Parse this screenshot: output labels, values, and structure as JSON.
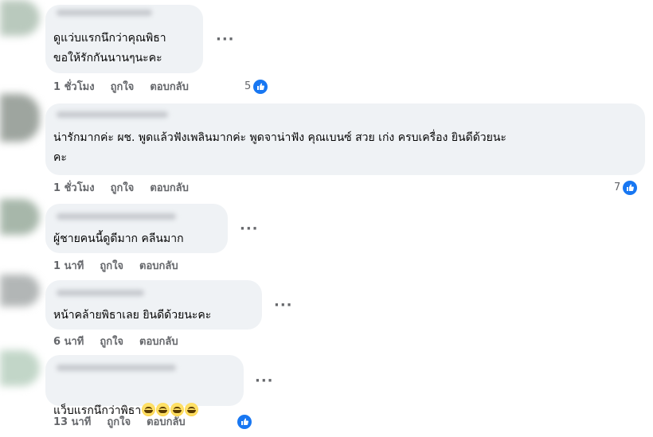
{
  "comments": [
    {
      "text": "ดูแว่บแรกนึกว่าคุณพิธา\nขอให้รักกันนานๆนะคะ",
      "time": "1 ชั่วโมง",
      "like_label": "ถูกใจ",
      "reply_label": "ตอบกลับ",
      "reaction_count": "5"
    },
    {
      "text": "น่ารักมากค่ะ ผช. พูดแล้วฟังเพลินมากค่ะ พูดจาน่าฟัง คุณเบนซ์ สวย เก่ง ครบเครื่อง ยินดีด้วยนะ\nคะ",
      "time": "1 ชั่วโมง",
      "like_label": "ถูกใจ",
      "reply_label": "ตอบกลับ",
      "reaction_count": "7"
    },
    {
      "text": "ผู้ชายคนนี้ดูดีมาก คลีนมาก",
      "time": "1 นาที",
      "like_label": "ถูกใจ",
      "reply_label": "ตอบกลับ"
    },
    {
      "text": "หน้าคล้ายพิธาเลย ยินดีด้วยนะคะ",
      "time": "6 นาที",
      "like_label": "ถูกใจ",
      "reply_label": "ตอบกลับ"
    },
    {
      "text": "แว็บแรกนึกว่าพิธา",
      "emoji": "😅😅😅😅",
      "time": "13 นาที",
      "like_label": "ถูกใจ",
      "reply_label": "ตอบกลับ",
      "reaction_count": ""
    }
  ],
  "more_label": "···",
  "colors": {
    "bubble": "#eff2f5",
    "meta": "#65676b",
    "like_blue": "#1877f2"
  },
  "icons": [
    "more-options-icon",
    "like-reaction-icon",
    "grinning-sweat-emoji-icon"
  ]
}
